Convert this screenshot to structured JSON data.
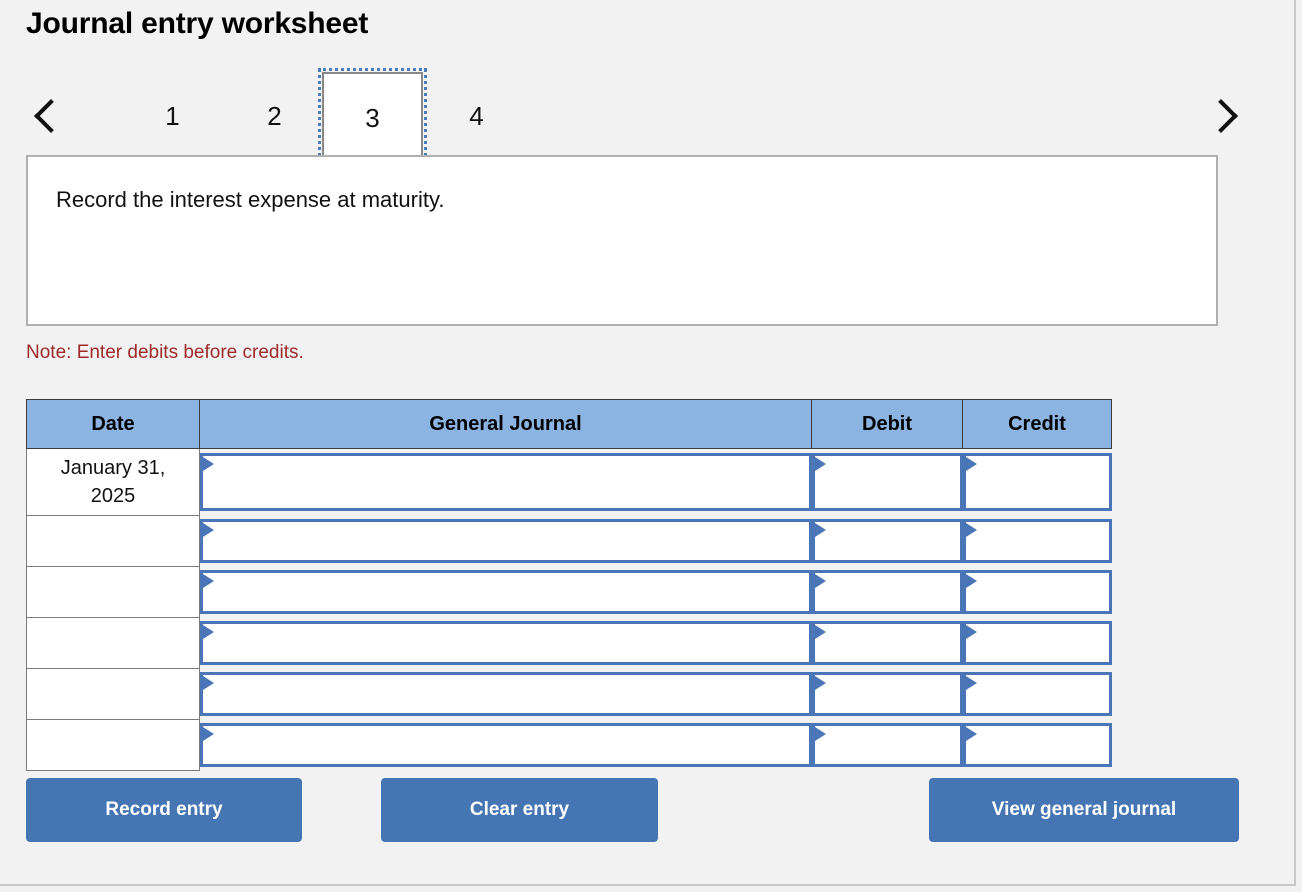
{
  "page": {
    "title": "Journal entry worksheet"
  },
  "pager": {
    "prev_icon": "chevron-left-icon",
    "next_icon": "chevron-right-icon",
    "pages": [
      {
        "label": "1",
        "active": false
      },
      {
        "label": "2",
        "active": false
      },
      {
        "label": "3",
        "active": true
      },
      {
        "label": "4",
        "active": false
      }
    ],
    "selected": "3"
  },
  "instruction": {
    "text": "Record the interest expense at maturity."
  },
  "note": {
    "text": "Note: Enter debits before credits."
  },
  "table": {
    "headers": {
      "date": "Date",
      "general_journal": "General Journal",
      "debit": "Debit",
      "credit": "Credit"
    },
    "rows": [
      {
        "date": "January 31, 2025",
        "general_journal": "",
        "debit": "",
        "credit": ""
      },
      {
        "date": "",
        "general_journal": "",
        "debit": "",
        "credit": ""
      },
      {
        "date": "",
        "general_journal": "",
        "debit": "",
        "credit": ""
      },
      {
        "date": "",
        "general_journal": "",
        "debit": "",
        "credit": ""
      },
      {
        "date": "",
        "general_journal": "",
        "debit": "",
        "credit": ""
      },
      {
        "date": "",
        "general_journal": "",
        "debit": "",
        "credit": ""
      }
    ]
  },
  "buttons": {
    "record": "Record entry",
    "clear": "Clear entry",
    "view": "View general journal"
  },
  "colors": {
    "header_blue": "#8cb4e2",
    "button_blue": "#4675b4",
    "input_border_blue": "#4a76b8",
    "note_red": "#9e2a2a",
    "page_background": "#f2f2f2",
    "focus_outline": "#4a7ebb"
  }
}
